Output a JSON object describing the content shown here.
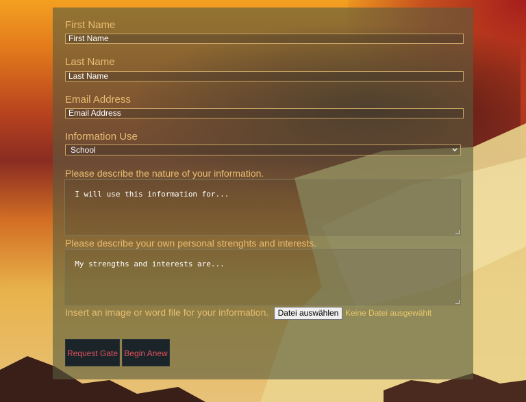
{
  "form": {
    "first_name": {
      "label": "First Name",
      "placeholder": "First Name"
    },
    "last_name": {
      "label": "Last Name",
      "placeholder": "Last Name"
    },
    "email": {
      "label": "Email Address",
      "placeholder": "Email Address"
    },
    "information_use": {
      "label": "Information Use",
      "selected": "School"
    },
    "nature": {
      "label": "Please describe the nature of your information.",
      "value": "I will use this information for..."
    },
    "strengths": {
      "label": "Please describe your own personal strenghts and interests.",
      "value": "My strengths and interests are..."
    },
    "file": {
      "label": "Insert an image or word file for your information.",
      "button": "Datei auswählen",
      "status": "Keine Datei ausgewählt"
    },
    "buttons": {
      "submit": "Request Gate",
      "reset": "Begin Anew"
    }
  },
  "icons": {
    "select_arrow": "chevron-down-icon",
    "resize": "resize-grip-icon"
  },
  "colors": {
    "label": "#e8bd72",
    "button_text": "#e2525e",
    "button_bg": "#1b2429",
    "file_status": "#e8c76a"
  }
}
